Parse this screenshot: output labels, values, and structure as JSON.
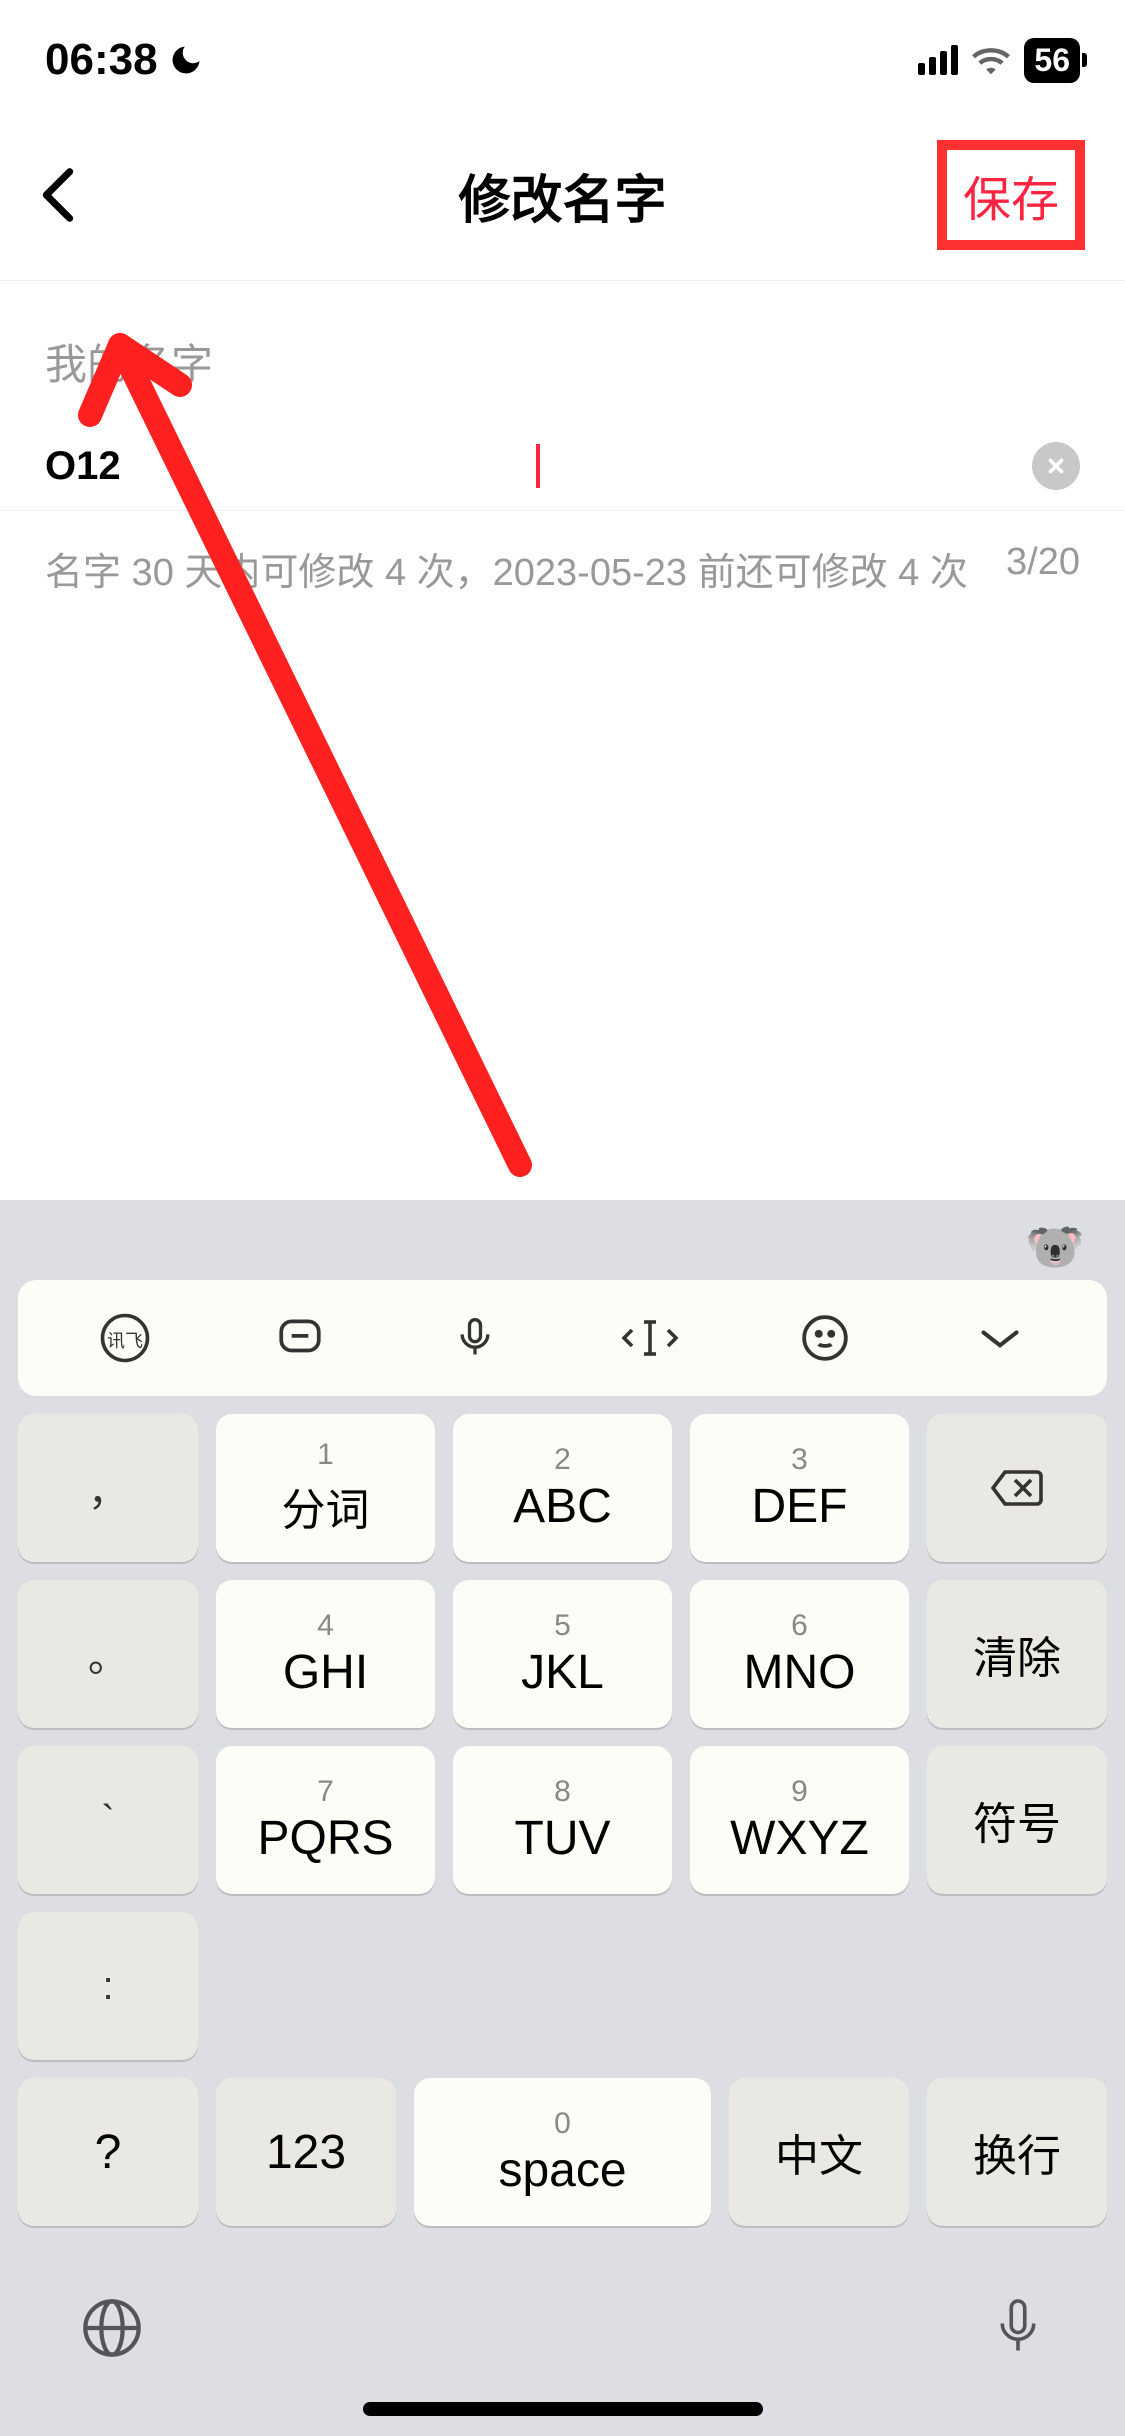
{
  "status": {
    "time": "06:38",
    "battery": "56"
  },
  "nav": {
    "title": "修改名字",
    "save": "保存"
  },
  "section": {
    "label": "我的名字",
    "input_value": "O12",
    "hint": "名字 30 天内可修改 4 次，2023-05-23 前还可修改 4 次",
    "counter": "3/20"
  },
  "keyboard": {
    "left": [
      "，",
      "。",
      "`",
      ":"
    ],
    "keys": [
      {
        "num": "1",
        "main": "分词"
      },
      {
        "num": "2",
        "main": "ABC"
      },
      {
        "num": "3",
        "main": "DEF"
      },
      {
        "num": "4",
        "main": "GHI"
      },
      {
        "num": "5",
        "main": "JKL"
      },
      {
        "num": "6",
        "main": "MNO"
      },
      {
        "num": "7",
        "main": "PQRS"
      },
      {
        "num": "8",
        "main": "TUV"
      },
      {
        "num": "9",
        "main": "WXYZ"
      }
    ],
    "right": {
      "clear": "清除",
      "symbol": "符号",
      "newline": "换行"
    },
    "bottom": {
      "question": "?",
      "num": "123",
      "space_num": "0",
      "space": "space",
      "chinese": "中文"
    }
  }
}
